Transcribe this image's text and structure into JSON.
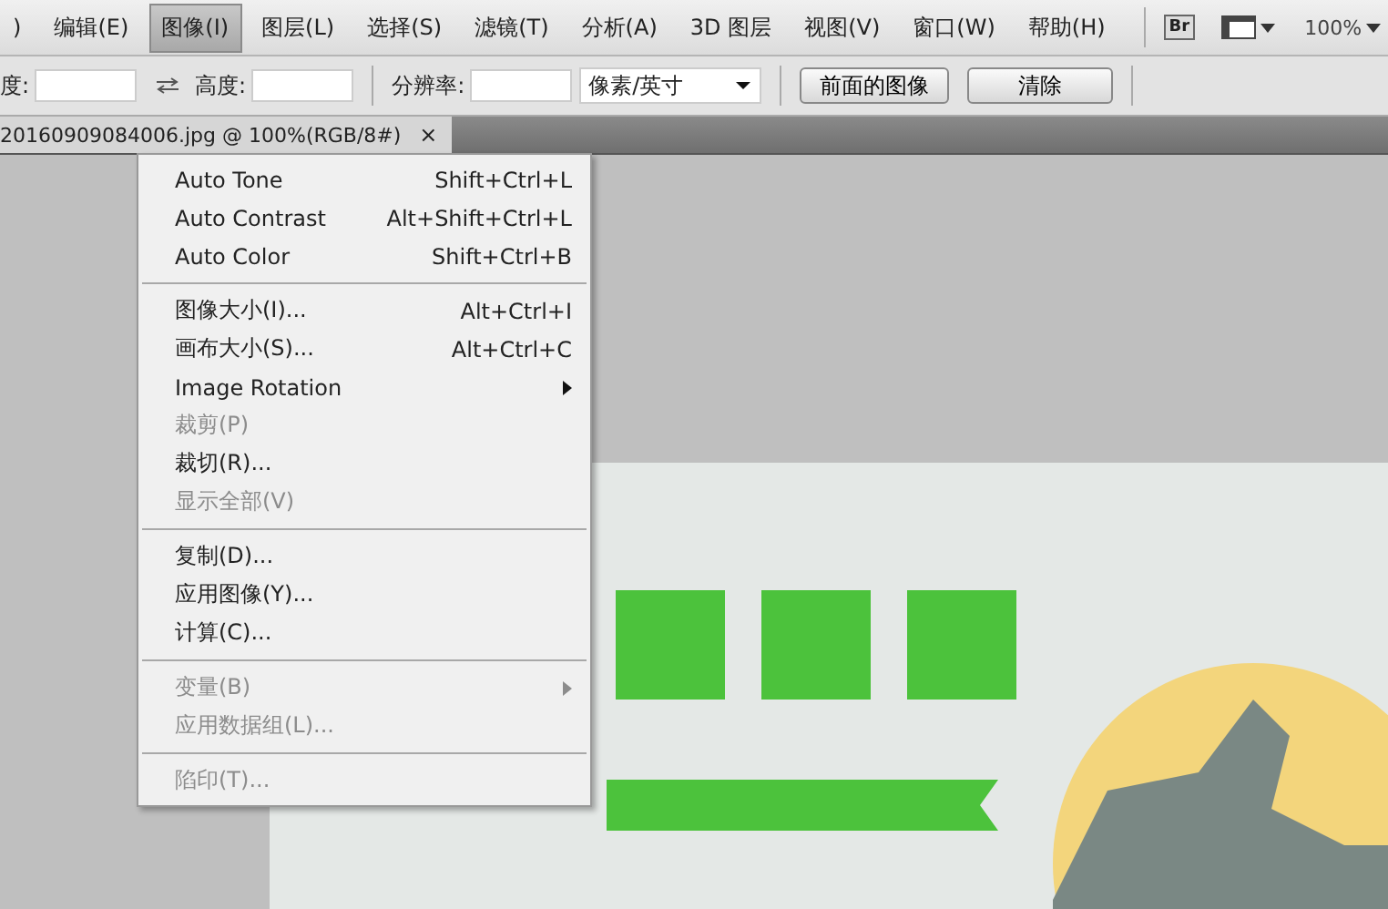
{
  "menu_bar": {
    "items": [
      {
        "label": ")",
        "selected": false
      },
      {
        "label": "编辑(E)",
        "selected": false
      },
      {
        "label": "图像(I)",
        "selected": true
      },
      {
        "label": "图层(L)",
        "selected": false
      },
      {
        "label": "选择(S)",
        "selected": false
      },
      {
        "label": "滤镜(T)",
        "selected": false
      },
      {
        "label": "分析(A)",
        "selected": false
      },
      {
        "label": "3D 图层",
        "selected": false
      },
      {
        "label": "视图(V)",
        "selected": false
      },
      {
        "label": "窗口(W)",
        "selected": false
      },
      {
        "label": "帮助(H)",
        "selected": false
      }
    ],
    "bridge_button": "Br",
    "zoom": "100%"
  },
  "options_bar": {
    "width_label": "度:",
    "height_label": "高度:",
    "resolution_label": "分辨率:",
    "unit": "像素/英寸",
    "buttons": [
      "前面的图像",
      "清除"
    ]
  },
  "document_tab": {
    "title": "20160909084006.jpg @ 100%(RGB/8#)",
    "close": "×"
  },
  "image_menu": [
    {
      "kind": "item",
      "label": "Auto Tone",
      "shortcut": "Shift+Ctrl+L",
      "disabled": false,
      "submenu": false
    },
    {
      "kind": "item",
      "label": "Auto Contrast",
      "shortcut": "Alt+Shift+Ctrl+L",
      "disabled": false,
      "submenu": false
    },
    {
      "kind": "item",
      "label": "Auto Color",
      "shortcut": "Shift+Ctrl+B",
      "disabled": false,
      "submenu": false
    },
    {
      "kind": "separator"
    },
    {
      "kind": "item",
      "label": "图像大小(I)...",
      "shortcut": "Alt+Ctrl+I",
      "disabled": false,
      "submenu": false
    },
    {
      "kind": "item",
      "label": "画布大小(S)...",
      "shortcut": "Alt+Ctrl+C",
      "disabled": false,
      "submenu": false
    },
    {
      "kind": "item",
      "label": "Image Rotation",
      "disabled": false,
      "submenu": true
    },
    {
      "kind": "item",
      "label": "裁剪(P)",
      "disabled": true,
      "submenu": false
    },
    {
      "kind": "item",
      "label": "裁切(R)...",
      "disabled": false,
      "submenu": false
    },
    {
      "kind": "item",
      "label": "显示全部(V)",
      "disabled": true,
      "submenu": false
    },
    {
      "kind": "separator"
    },
    {
      "kind": "item",
      "label": "复制(D)...",
      "disabled": false,
      "submenu": false
    },
    {
      "kind": "item",
      "label": "应用图像(Y)...",
      "disabled": false,
      "submenu": false
    },
    {
      "kind": "item",
      "label": "计算(C)...",
      "disabled": false,
      "submenu": false
    },
    {
      "kind": "separator"
    },
    {
      "kind": "item",
      "label": "变量(B)",
      "disabled": true,
      "submenu": true
    },
    {
      "kind": "item",
      "label": "应用数据组(L)...",
      "disabled": true,
      "submenu": false
    },
    {
      "kind": "separator"
    },
    {
      "kind": "item",
      "label": "陷印(T)...",
      "disabled": true,
      "submenu": false
    }
  ]
}
